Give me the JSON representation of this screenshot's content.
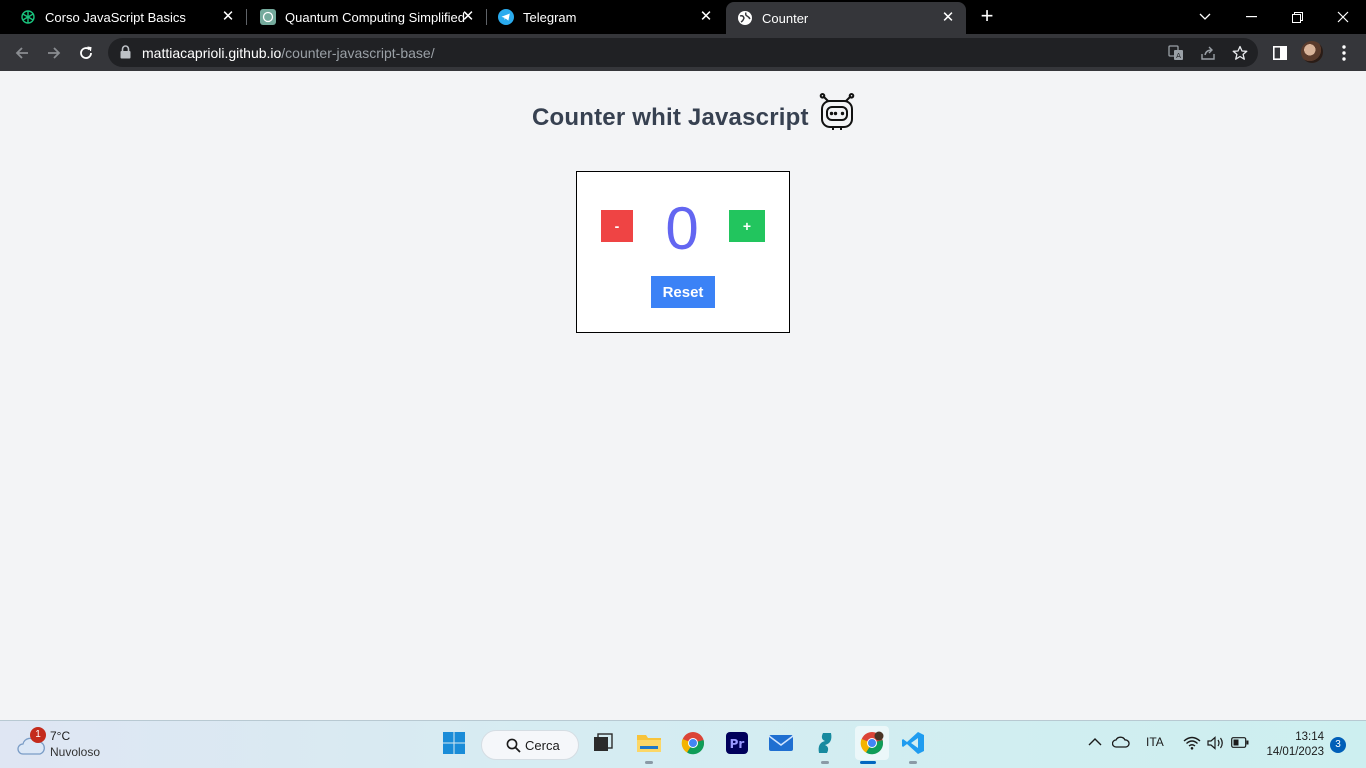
{
  "browser": {
    "tabs": [
      {
        "title": "Corso JavaScript Basics",
        "icon": "openai-icon",
        "active": false
      },
      {
        "title": "Quantum Computing Simplified",
        "icon": "chatgpt-icon",
        "active": false
      },
      {
        "title": "Telegram",
        "icon": "telegram-icon",
        "active": false
      },
      {
        "title": "Counter",
        "icon": "globe-icon",
        "active": true
      }
    ],
    "new_tab": "+",
    "url_host": "mattiacaprioli.github.io",
    "url_path": "/counter-javascript-base/"
  },
  "page": {
    "title": "Counter whit Javascript",
    "minus_label": "-",
    "plus_label": "+",
    "count": "0",
    "reset_label": "Reset",
    "colors": {
      "minus": "#ef4444",
      "plus": "#22c55e",
      "count": "#6366f1",
      "reset": "#3b82f6"
    }
  },
  "taskbar": {
    "weather_temp": "7°C",
    "weather_cond": "Nuvoloso",
    "weather_badge": "1",
    "search_label": "Cerca",
    "language": "ITA",
    "time": "13:14",
    "date": "14/01/2023",
    "notifications": "3"
  }
}
